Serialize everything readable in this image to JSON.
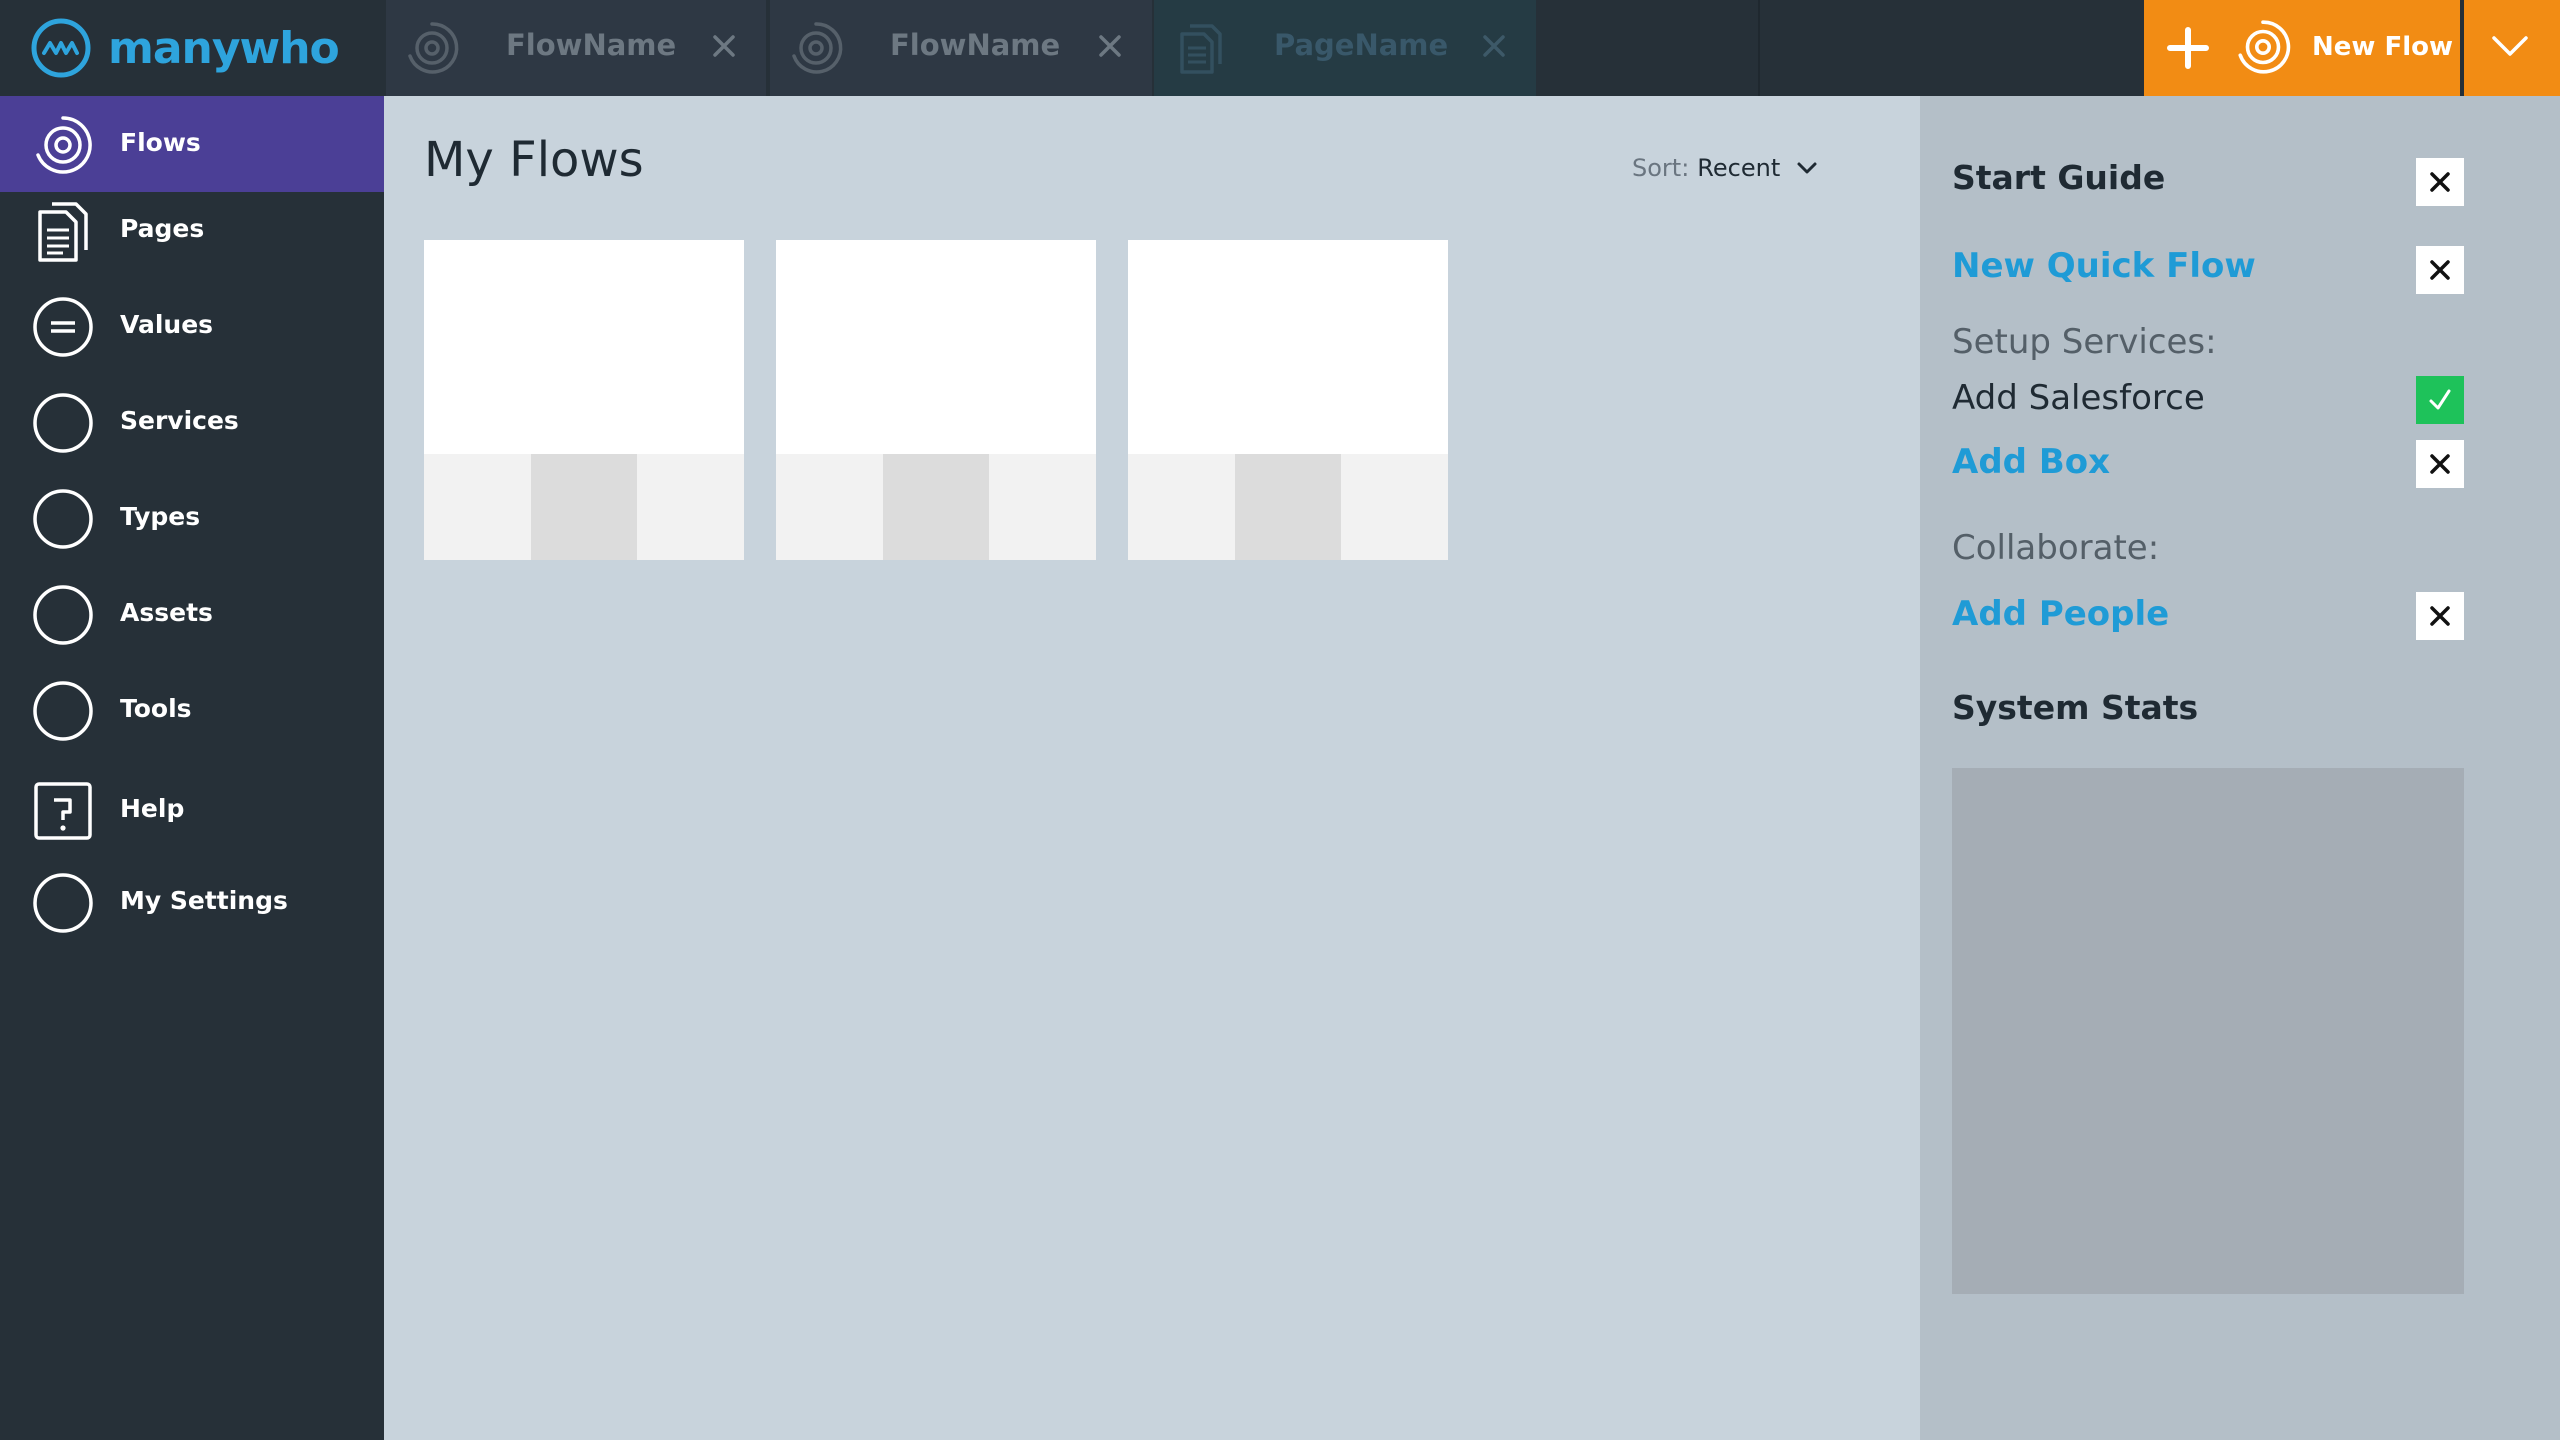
{
  "app": {
    "logo_text": "manywho",
    "colors": {
      "topbar": "#263038",
      "accent_purple": "#4b3f96",
      "brand_orange": "#f28c14",
      "link_blue": "#1f9bd6",
      "check_green": "#1ec25a"
    }
  },
  "tabs": [
    {
      "label": "FlowName",
      "icon": "flow-icon"
    },
    {
      "label": "FlowName",
      "icon": "flow-icon"
    },
    {
      "label": "PageName",
      "icon": "page-icon"
    }
  ],
  "new_flow": {
    "label": "New Flow"
  },
  "sidebar": {
    "items": [
      {
        "label": "Flows",
        "icon": "flow-icon",
        "active": true
      },
      {
        "label": "Pages",
        "icon": "page-icon"
      },
      {
        "label": "Values",
        "icon": "values-icon"
      },
      {
        "label": "Services",
        "icon": "circle-icon"
      },
      {
        "label": "Types",
        "icon": "circle-icon"
      },
      {
        "label": "Assets",
        "icon": "circle-icon"
      },
      {
        "label": "Tools",
        "icon": "circle-icon"
      },
      {
        "label": "Help",
        "icon": "help-icon"
      },
      {
        "label": "My Settings",
        "icon": "circle-icon"
      }
    ]
  },
  "main": {
    "title": "My Flows",
    "sort": {
      "label": "Sort:",
      "value": "Recent"
    },
    "cards": [
      {},
      {},
      {}
    ]
  },
  "right_panel": {
    "start_guide": "Start Guide",
    "new_quick_flow": "New Quick Flow",
    "setup_services": "Setup Services:",
    "add_salesforce": "Add Salesforce",
    "add_box": "Add Box",
    "collaborate": "Collaborate:",
    "add_people": "Add People",
    "system_stats": "System Stats"
  }
}
